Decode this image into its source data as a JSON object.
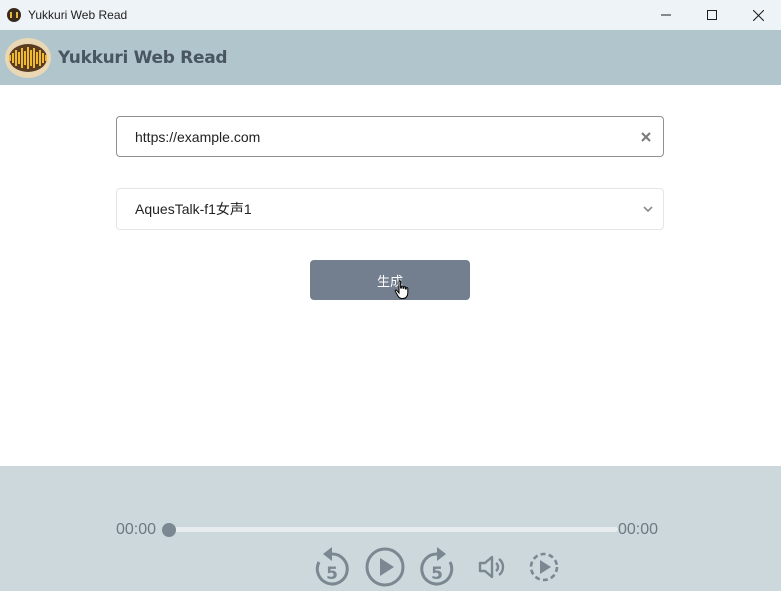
{
  "window": {
    "title": "Yukkuri Web Read",
    "controls": [
      "minimize-icon",
      "maximize-icon",
      "close-icon"
    ]
  },
  "header": {
    "app_name": "Yukkuri Web Read",
    "logo_icon": "sound-wave-logo"
  },
  "form": {
    "url": {
      "value": "https://example.com",
      "clear_icon": "clear-x-icon"
    },
    "voice": {
      "selected": "AquesTalk-f1女声1",
      "icon": "chevron-down-icon"
    },
    "generate_label": "生成"
  },
  "player": {
    "current_time": "00:00",
    "duration": "00:00",
    "progress": 0,
    "controls": [
      "rewind-5-icon",
      "play-icon",
      "forward-5-icon",
      "volume-icon",
      "playback-rate-icon"
    ],
    "rewind_seconds": "5",
    "forward_seconds": "5"
  },
  "colors": {
    "header_bg": "#b1c6cc",
    "player_bg": "#cdd8dc",
    "button_bg": "#737f8e",
    "icon_color": "#7b8791"
  }
}
